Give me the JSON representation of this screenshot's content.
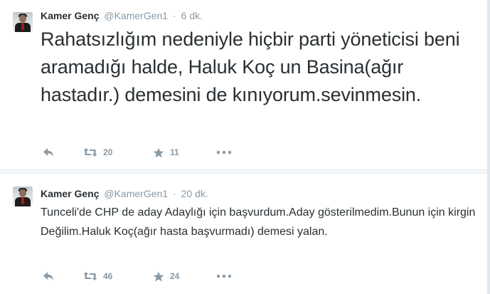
{
  "tweets": [
    {
      "author_name": "Kamer Genç",
      "handle": "@KamerGen1",
      "separator": "·",
      "time": "6 dk.",
      "text": "Rahatsızlığım nedeniyle hiçbir parti yöneticisi beni aramadığı halde, Haluk Koç un Basina(ağır hastadır.) demesini de kınıyorum.sevinmesin.",
      "retweet_count": "20",
      "favorite_count": "11",
      "avatar_icon": "profile-photo"
    },
    {
      "author_name": "Kamer Genç",
      "handle": "@KamerGen1",
      "separator": "·",
      "time": "20 dk.",
      "text": "Tunceli'de CHP de aday Adaylığı için başvurdum.Aday gösterilmedim.Bunun için kirgin Değilim.Haluk Koç(ağır hasta başvurmadı) demesi yalan.",
      "retweet_count": "46",
      "favorite_count": "24",
      "avatar_icon": "profile-photo"
    }
  ],
  "icons": {
    "reply": "reply-icon",
    "retweet": "retweet-icon",
    "favorite": "star-icon",
    "more": "more-dots-icon"
  },
  "colors": {
    "text": "#292f33",
    "muted": "#8899a6",
    "action_icon": "#8899a6",
    "divider": "#e1e8ed"
  }
}
